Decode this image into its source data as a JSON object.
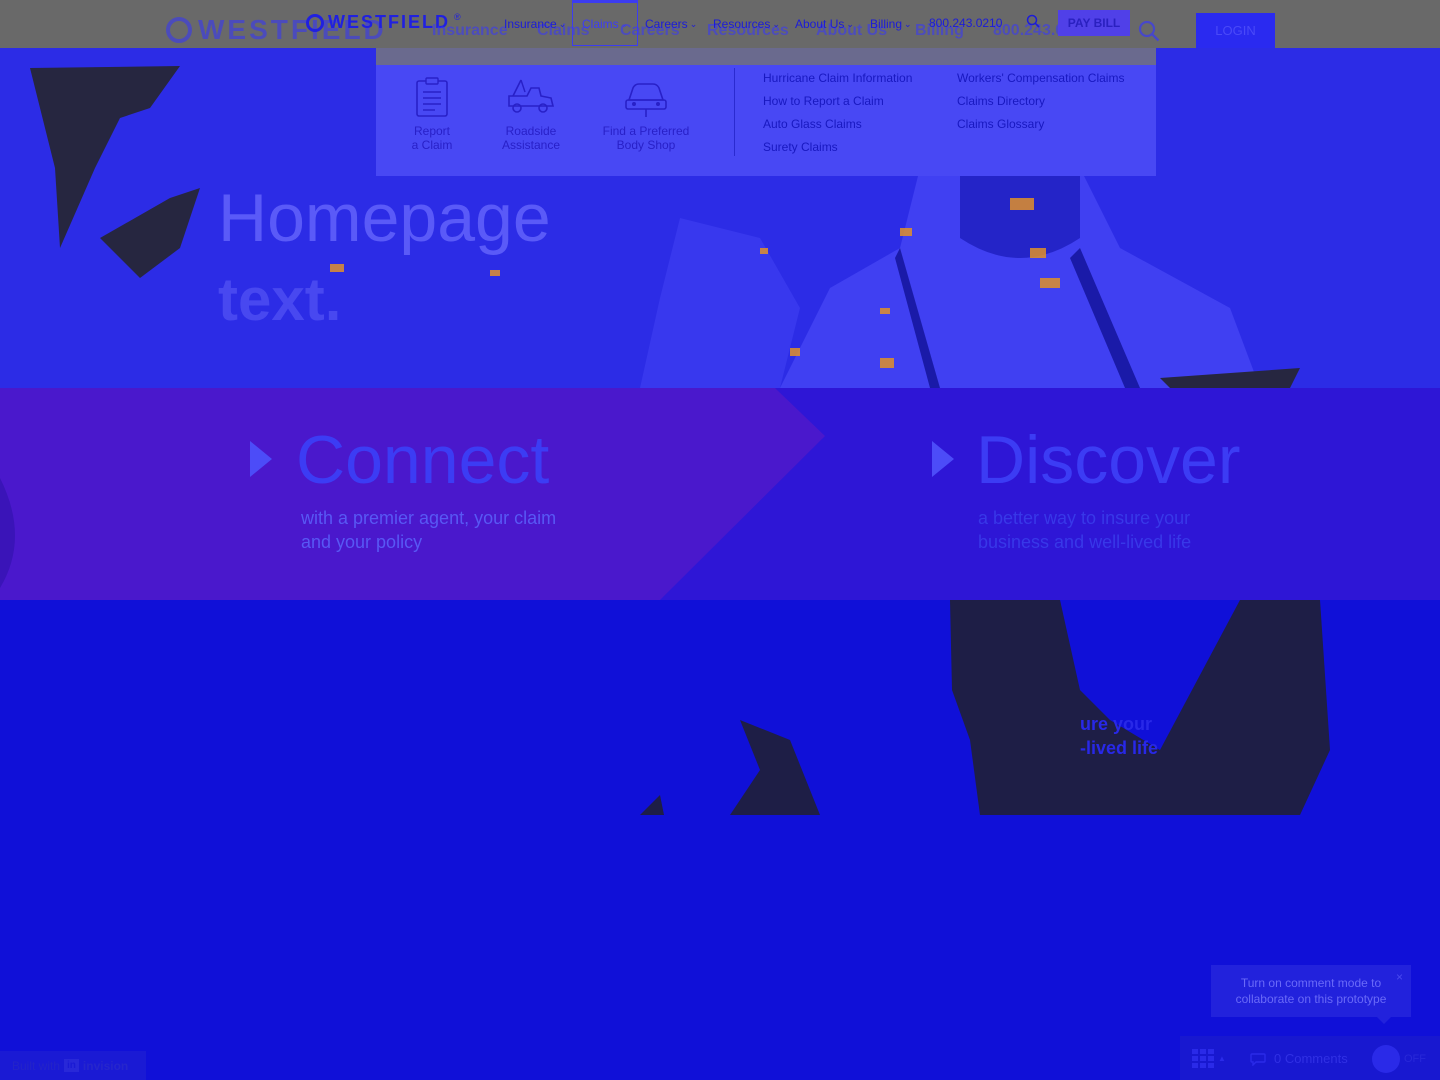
{
  "brand": {
    "logo_text": "WESTFIELD",
    "logo_reg": "®"
  },
  "nav": {
    "ghost_items": [
      "Insurance",
      "Claims",
      "Careers",
      "Resources",
      "About Us",
      "Billing",
      "800.243.0210"
    ],
    "items": [
      {
        "label": "Insurance"
      },
      {
        "label": "Claims"
      },
      {
        "label": "Careers"
      },
      {
        "label": "Resources"
      },
      {
        "label": "About Us"
      },
      {
        "label": "Billing"
      }
    ],
    "phone": "800.243.0210",
    "pay_bill": "PAY BILL",
    "login": "LOGIN"
  },
  "claims_menu": {
    "tiles": [
      {
        "line1": "Report",
        "line2": "a Claim",
        "icon": "clipboard-icon"
      },
      {
        "line1": "Roadside",
        "line2": "Assistance",
        "icon": "tow-truck-icon"
      },
      {
        "line1": "Find a Preferred",
        "line2": "Body Shop",
        "icon": "car-icon"
      }
    ],
    "links_col1": [
      "Hurricane Claim Information",
      "How to Report a Claim",
      "Auto Glass Claims",
      "Surety Claims"
    ],
    "links_col2": [
      "Workers' Compensation Claims",
      "Claims Directory",
      "Claims Glossary"
    ]
  },
  "hero": {
    "title": "Homepage",
    "subtitle": "text."
  },
  "features": {
    "connect": {
      "title": "Connect",
      "text_line1": "with a premier agent, your claim",
      "text_line2": "and your policy"
    },
    "discover": {
      "title": "Discover",
      "text_line1": "a better way to insure your",
      "text_line2": "business and well-lived life"
    }
  },
  "lower": {
    "line1": "ure your",
    "line2": "-lived life"
  },
  "invision": {
    "tooltip": "Turn on comment mode to collaborate on this prototype",
    "tooltip_close": "×",
    "comments": "0 Comments",
    "toggle": "OFF",
    "built_with": "Built with",
    "brand": "invision",
    "brand_badge": "in"
  },
  "colors": {
    "background": "#1010d8",
    "topbar": "#696969",
    "dropdown": "#4848f4",
    "accent": "#3c3cf4",
    "band": "#2e16d6",
    "connect_panel": "#4a18cc"
  }
}
